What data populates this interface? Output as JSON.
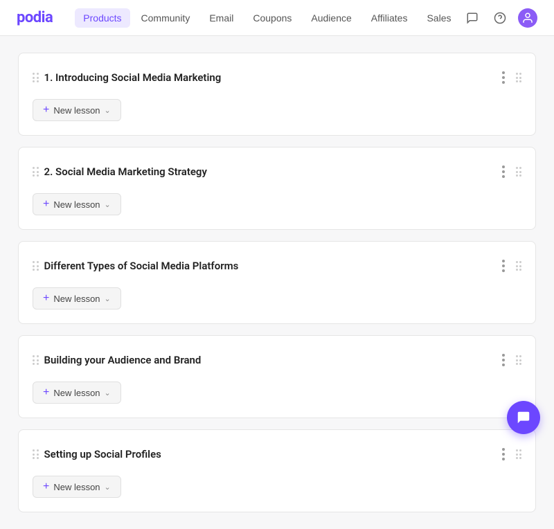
{
  "header": {
    "logo": "podia",
    "nav": [
      {
        "label": "Products",
        "active": true
      },
      {
        "label": "Community",
        "active": false
      },
      {
        "label": "Email",
        "active": false
      },
      {
        "label": "Coupons",
        "active": false
      },
      {
        "label": "Audience",
        "active": false
      },
      {
        "label": "Affiliates",
        "active": false
      },
      {
        "label": "Sales",
        "active": false
      }
    ],
    "icons": {
      "chat": "💬",
      "help": "?",
      "avatar": "A"
    }
  },
  "sections": [
    {
      "id": 1,
      "title": "1. Introducing Social Media Marketing",
      "new_lesson_label": "New lesson"
    },
    {
      "id": 2,
      "title": "2. Social Media Marketing Strategy",
      "new_lesson_label": "New lesson"
    },
    {
      "id": 3,
      "title": "Different Types of Social Media Platforms",
      "new_lesson_label": "New lesson"
    },
    {
      "id": 4,
      "title": "Building your Audience and Brand",
      "new_lesson_label": "New lesson"
    },
    {
      "id": 5,
      "title": "Setting up Social Profiles",
      "new_lesson_label": "New lesson"
    }
  ],
  "new_lesson_plus": "+",
  "new_lesson_chevron": "∨"
}
